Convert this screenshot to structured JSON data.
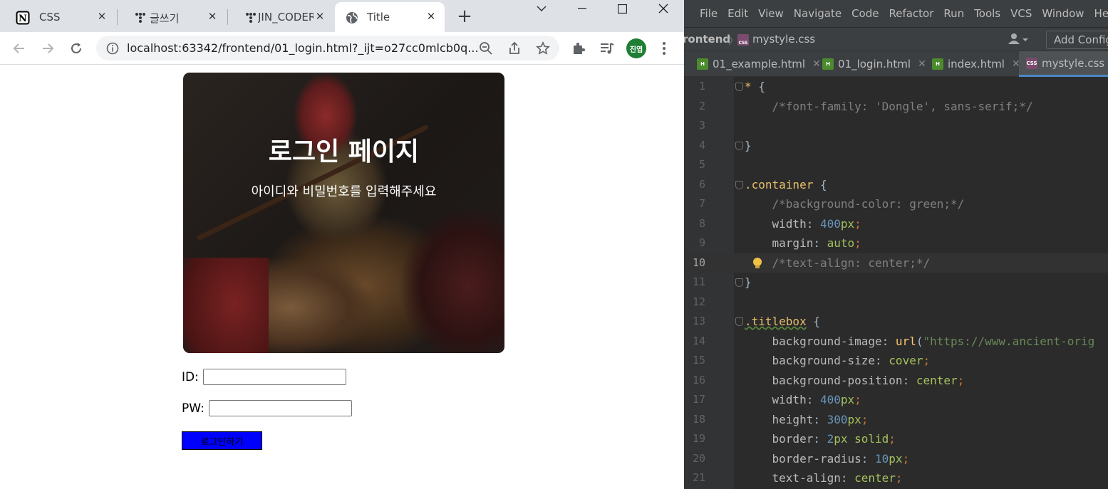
{
  "browser": {
    "tabs": [
      {
        "title": "CSS",
        "icon": "notion-icon"
      },
      {
        "title": "글쓰기",
        "icon": "tistory-icon"
      },
      {
        "title": "JIN_CODER",
        "icon": "tistory-icon"
      },
      {
        "title": "Title",
        "icon": "globe-icon",
        "active": true
      }
    ],
    "url": "localhost:63342/frontend/01_login.html?_ijt=o27cc0mlcb0q...",
    "profile_initials": "진엽"
  },
  "page": {
    "title": "로그인 페이지",
    "subtitle": "아이디와 비밀번호를 입력해주세요",
    "id_label": "ID:",
    "pw_label": "PW:",
    "login_button": "로그인하기",
    "button_color": "#0000ff"
  },
  "ide": {
    "menu": [
      "File",
      "Edit",
      "View",
      "Navigate",
      "Code",
      "Refactor",
      "Run",
      "Tools",
      "VCS",
      "Window",
      "Help"
    ],
    "breadcrumb": {
      "project": "rontend",
      "file": "mystyle.css"
    },
    "add_config": "Add Configu",
    "tabs": [
      {
        "name": "01_example.html",
        "type": "html"
      },
      {
        "name": "01_login.html",
        "type": "html"
      },
      {
        "name": "index.html",
        "type": "html"
      },
      {
        "name": "mystyle.css",
        "type": "css",
        "active": true
      }
    ],
    "current_line": 10,
    "code": [
      {
        "n": "1"
      },
      {
        "n": "2",
        "c": "/*font-family: 'Dongle', sans-serif;*/"
      },
      {
        "n": "3"
      },
      {
        "n": "4"
      },
      {
        "n": "5"
      },
      {
        "n": "6",
        "sel": ".container"
      },
      {
        "n": "7",
        "c": "/*background-color: green;*/"
      },
      {
        "n": "8",
        "p": "width",
        "v": "400",
        "u": "px"
      },
      {
        "n": "9",
        "p": "margin",
        "v": "auto"
      },
      {
        "n": "10",
        "c": "/*text-align: center;*/"
      },
      {
        "n": "11"
      },
      {
        "n": "12"
      },
      {
        "n": "13",
        "sel": ".titlebox"
      },
      {
        "n": "14",
        "p": "background-image",
        "f": "url",
        "s": "\"https://www.ancient-orig"
      },
      {
        "n": "15",
        "p": "background-size",
        "v": "cover"
      },
      {
        "n": "16",
        "p": "background-position",
        "v": "center"
      },
      {
        "n": "17",
        "p": "width",
        "v": "400",
        "u": "px"
      },
      {
        "n": "18",
        "p": "height",
        "v": "300",
        "u": "px"
      },
      {
        "n": "19",
        "p": "border",
        "v": "2px solid"
      },
      {
        "n": "20",
        "p": "border-radius",
        "v": "10",
        "u": "px"
      },
      {
        "n": "21",
        "p": "text-align",
        "v": "center"
      }
    ]
  }
}
